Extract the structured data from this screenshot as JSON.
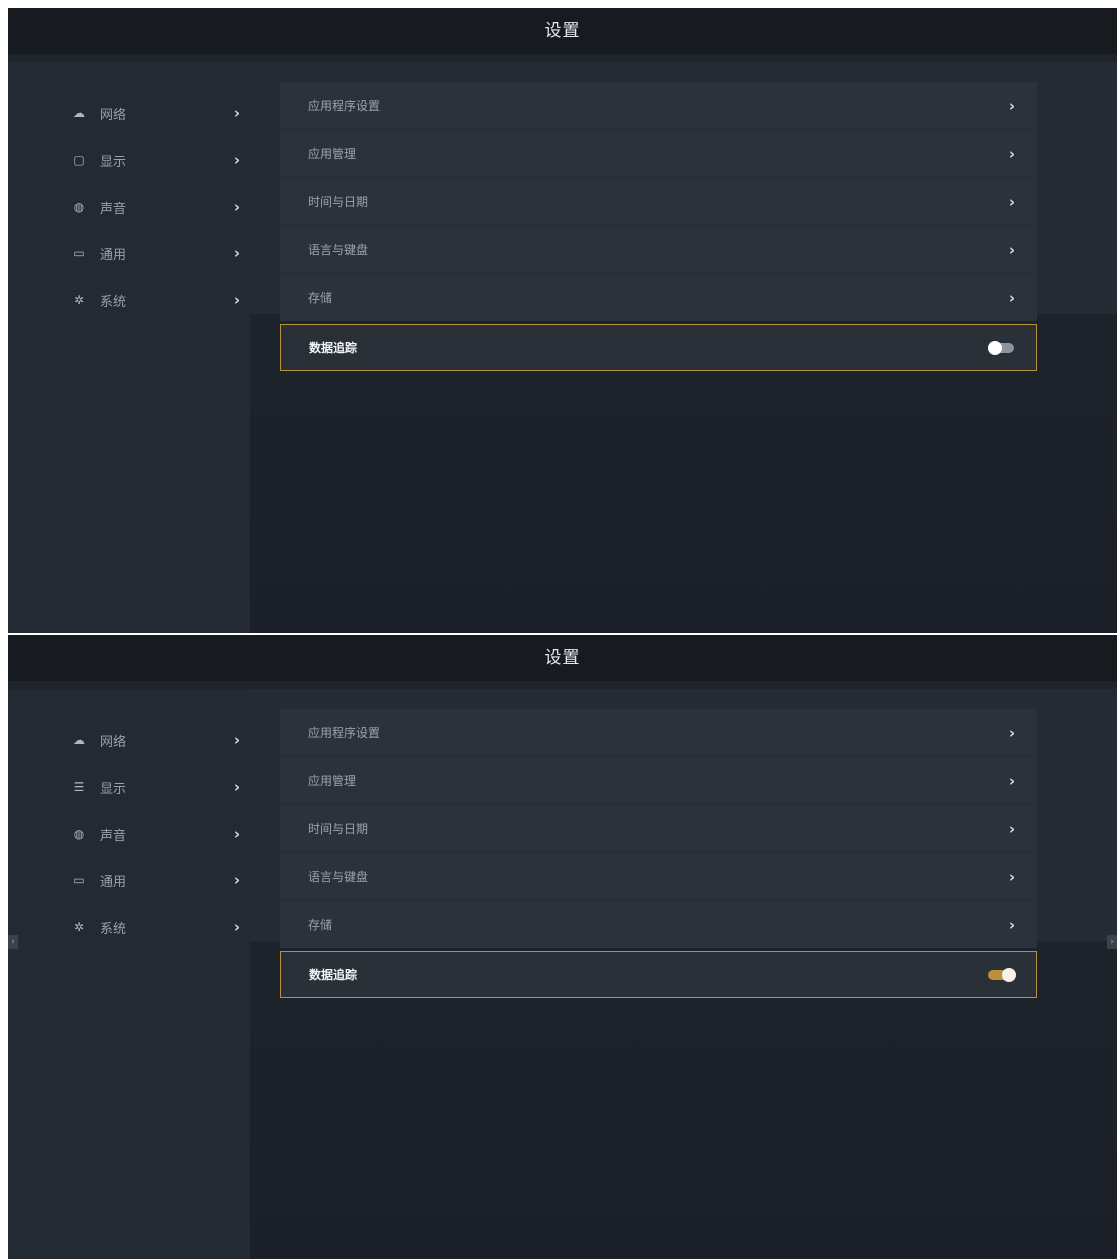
{
  "screens": [
    {
      "title": "设置",
      "sidebar": [
        {
          "icon": "cloud-icon",
          "glyph": "☁",
          "label": "网络"
        },
        {
          "icon": "display-icon",
          "glyph": "▢",
          "label": "显示"
        },
        {
          "icon": "speaker-icon",
          "glyph": "◍",
          "label": "声音"
        },
        {
          "icon": "calendar-icon",
          "glyph": "▭",
          "label": "通用"
        },
        {
          "icon": "gear-icon",
          "glyph": "✲",
          "label": "系统"
        }
      ],
      "rows": [
        {
          "label": "应用程序设置"
        },
        {
          "label": "应用管理"
        },
        {
          "label": "时间与日期"
        },
        {
          "label": "语言与键盘"
        },
        {
          "label": "存储"
        },
        {
          "label": "数据追踪",
          "toggle": "off"
        }
      ]
    },
    {
      "title": "设置",
      "sidebar": [
        {
          "icon": "cloud-icon",
          "glyph": "☁",
          "label": "网络"
        },
        {
          "icon": "display-icon",
          "glyph": "☰",
          "label": "显示"
        },
        {
          "icon": "speaker-icon",
          "glyph": "◍",
          "label": "声音"
        },
        {
          "icon": "calendar-icon",
          "glyph": "▭",
          "label": "通用"
        },
        {
          "icon": "gear-icon",
          "glyph": "✲",
          "label": "系统"
        }
      ],
      "rows": [
        {
          "label": "应用程序设置"
        },
        {
          "label": "应用管理"
        },
        {
          "label": "时间与日期"
        },
        {
          "label": "语言与键盘"
        },
        {
          "label": "存储"
        },
        {
          "label": "数据追踪",
          "toggle": "on"
        }
      ]
    }
  ],
  "chevron": "›",
  "edge_prev": "‹",
  "edge_next": "›"
}
